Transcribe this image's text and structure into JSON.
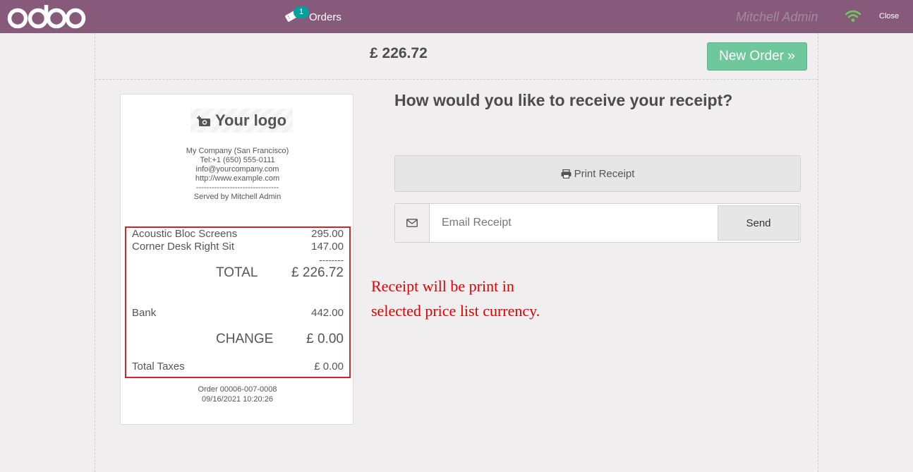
{
  "topbar": {
    "logo_text": "odoo",
    "orders_badge": "1",
    "orders_label": "Orders",
    "user_name": "Mitchell Admin",
    "close_label": "Close",
    "icons": [
      "ticket-icon",
      "wifi-icon"
    ]
  },
  "payment": {
    "total": "£ 226.72",
    "new_order_label": "New Order »"
  },
  "receipt": {
    "logo_text": "Your logo",
    "company_lines": [
      "My Company (San Francisco)",
      "Tel:+1 (650) 555-0111",
      "info@yourcompany.com",
      "http://www.example.com",
      "--------------------------------",
      "Served by Mitchell Admin"
    ],
    "lines": [
      {
        "name": "Acoustic Bloc Screens",
        "price": "295.00"
      },
      {
        "name": "Corner Desk Right Sit",
        "price": "147.00"
      }
    ],
    "separator": "--------",
    "total_label": "TOTAL",
    "total_value": "£ 226.72",
    "payment_name": "Bank",
    "payment_value": "442.00",
    "change_label": "CHANGE",
    "change_value": "£ 0.00",
    "taxes_label": "Total Taxes",
    "taxes_value": "£ 0.00",
    "order_ref": "Order 00006-007-0008",
    "order_date": "09/16/2021 10:20:26"
  },
  "receipt_options": {
    "question": "How would you like to receive your receipt?",
    "print_label": "Print Receipt",
    "email_placeholder": "Email Receipt",
    "send_label": "Send"
  },
  "annotation": {
    "line1": "Receipt will be print in",
    "line2": "selected price list currency.",
    "color": "#e00000"
  },
  "colors": {
    "topbar": "#875a7b",
    "new_order_button": "#6ec89b",
    "highlight_box": "#d6242b"
  }
}
